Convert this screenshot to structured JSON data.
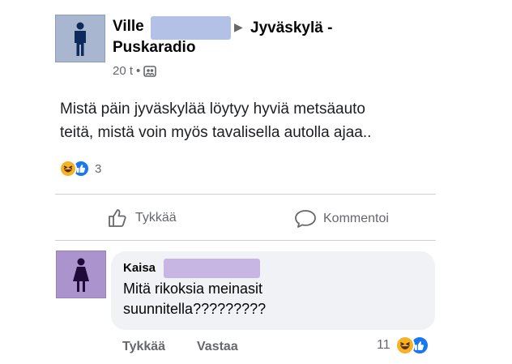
{
  "post": {
    "author_first": "Ville",
    "group_name_line1": "Jyväskylä -",
    "group_name_line2": "Puskaradio",
    "separator_glyph": "▶",
    "time": "20 t",
    "dot": "•",
    "body_line1": "Mistä päin jyväskylää löytyy hyviä metsäauto",
    "body_line2": "teitä, mistä voin myös tavalisella autolla ajaa..",
    "reaction_count": "3",
    "like_label": "Tykkää",
    "comment_label": "Kommentoi"
  },
  "comment": {
    "author_first": "Kaisa",
    "text_line1": "Mitä rikoksia meinasit",
    "text_line2": "suunnitella?????????",
    "like_label": "Tykkää",
    "reply_label": "Vastaa",
    "reaction_count": "11"
  },
  "colors": {
    "redact_male": "#b3c1e6",
    "redact_female": "#c7b5e3",
    "like_blue": "#1877f2",
    "haha_yellow": "#f7b125"
  },
  "icons": {
    "male": "male-user-icon",
    "female": "female-user-icon",
    "audience": "members-icon",
    "haha": "haha-reaction-icon",
    "like": "like-reaction-icon",
    "thumb": "thumbs-up-icon",
    "bubble": "comment-icon"
  }
}
